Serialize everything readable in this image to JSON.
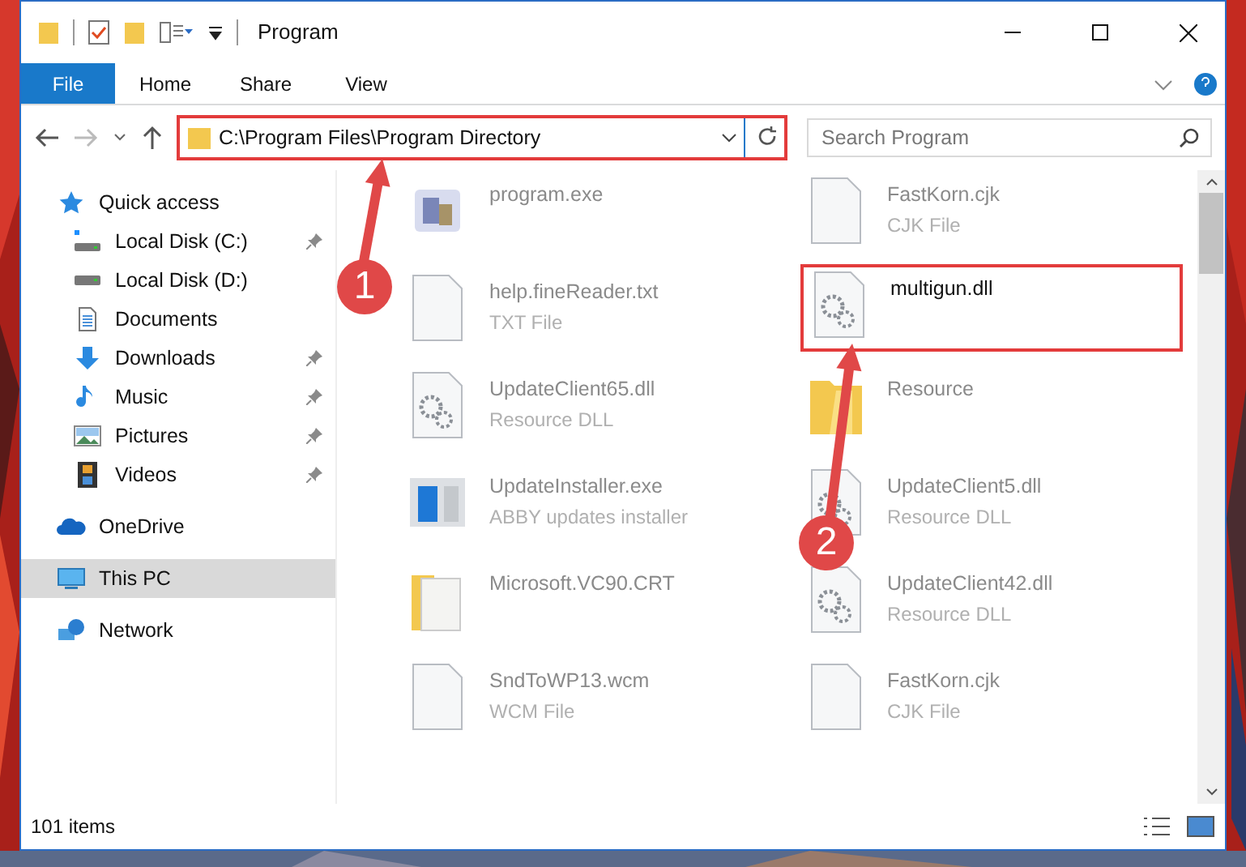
{
  "title_bar": {
    "title": "Program"
  },
  "ribbon_tabs": [
    {
      "label": "File",
      "selected": true
    },
    {
      "label": "Home",
      "selected": false
    },
    {
      "label": "Share",
      "selected": false
    },
    {
      "label": "View",
      "selected": false
    }
  ],
  "address_bar": {
    "path": "C:\\Program Files\\Program Directory",
    "highlighted": true
  },
  "search": {
    "placeholder": "Search Program"
  },
  "sidebar": {
    "items": [
      {
        "label": "Quick access",
        "kind": "star",
        "selected": false,
        "children": [
          {
            "label": "Local Disk (C:)",
            "kind": "systemdrive",
            "selected": false,
            "pinned": true
          },
          {
            "label": "Local Disk (D:)",
            "kind": "drive",
            "selected": false,
            "pinned": false
          },
          {
            "label": "Documents",
            "kind": "documents",
            "selected": false,
            "pinned": false
          },
          {
            "label": "Downloads",
            "kind": "downloads",
            "selected": false,
            "pinned": true
          },
          {
            "label": "Music",
            "kind": "music",
            "selected": false,
            "pinned": true
          },
          {
            "label": "Pictures",
            "kind": "pictures",
            "selected": false,
            "pinned": true
          },
          {
            "label": "Videos",
            "kind": "videos",
            "selected": false,
            "pinned": true
          }
        ]
      },
      {
        "label": "OneDrive",
        "kind": "cloud",
        "selected": false
      },
      {
        "label": "This PC",
        "kind": "pc",
        "selected": true
      },
      {
        "label": "Network",
        "kind": "network",
        "selected": false
      }
    ]
  },
  "files": [
    {
      "name": "program.exe",
      "kind": "exe",
      "blurred": true,
      "highlighted": false
    },
    {
      "name": "FastKorn.cjk",
      "type": "CJK File",
      "kind": "blank",
      "blurred": true,
      "highlighted": false
    },
    {
      "name": "help.fineReader.txt",
      "type": "TXT File",
      "kind": "blank",
      "blurred": true,
      "highlighted": false
    },
    {
      "name": "multigun.dll",
      "kind": "dll",
      "blurred": false,
      "highlighted": true
    },
    {
      "name": "UpdateClient65.dll",
      "type": "Resource DLL",
      "kind": "dll",
      "blurred": true,
      "highlighted": false
    },
    {
      "name": "Resource",
      "kind": "folder",
      "blurred": true,
      "highlighted": false
    },
    {
      "name": "UpdateInstaller.exe",
      "type": "ABBY updates installer",
      "kind": "installer",
      "blurred": true,
      "highlighted": false
    },
    {
      "name": "UpdateClient5.dll",
      "type": "Resource DLL",
      "kind": "dll",
      "blurred": true,
      "highlighted": false
    },
    {
      "name": "Microsoft.VC90.CRT",
      "kind": "zipfolder",
      "blurred": true,
      "highlighted": false
    },
    {
      "name": "UpdateClient42.dll",
      "type": "Resource DLL",
      "kind": "dll",
      "blurred": true,
      "highlighted": false
    },
    {
      "name": "SndToWP13.wcm",
      "type": "WCM File",
      "kind": "blank",
      "blurred": true,
      "highlighted": false
    },
    {
      "name": "FastKorn.cjk",
      "type": "CJK File",
      "kind": "blank",
      "blurred": true,
      "highlighted": false
    }
  ],
  "status_bar": {
    "item_count": "101 items"
  },
  "callouts": [
    {
      "number": "1"
    },
    {
      "number": "2"
    }
  ]
}
